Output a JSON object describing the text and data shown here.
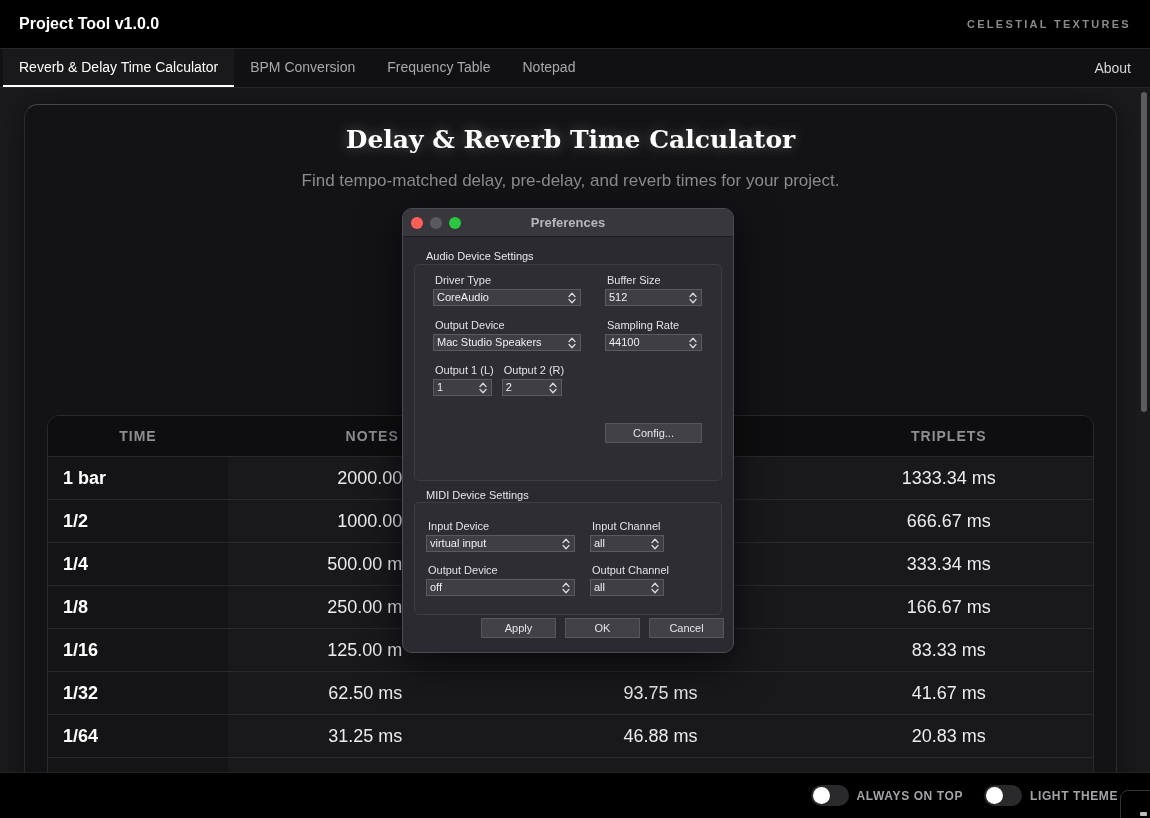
{
  "app": {
    "title": "Project Tool v1.0.0",
    "brand": "CELESTIAL TEXTURES"
  },
  "tabs": [
    {
      "label": "Reverb & Delay Time Calculator",
      "selected": true
    },
    {
      "label": "BPM Conversion",
      "selected": false
    },
    {
      "label": "Frequency Table",
      "selected": false
    },
    {
      "label": "Notepad",
      "selected": false
    }
  ],
  "about_link": "About",
  "calculator": {
    "heading": "Delay & Reverb Time Calculator",
    "subtitle": "Find tempo-matched delay, pre-delay, and reverb times for your project.",
    "table": {
      "headers": {
        "time": "TIME",
        "notes": "NOTES",
        "triplets": "TRIPLETS"
      },
      "rows": [
        {
          "time": "1 bar",
          "notes": "2000.00",
          "triplets": "1333.34 ms"
        },
        {
          "time": "1/2",
          "notes": "1000.00",
          "triplets": "666.67 ms"
        },
        {
          "time": "1/4",
          "notes": "500.00 m",
          "triplets": "333.34 ms"
        },
        {
          "time": "1/8",
          "notes": "250.00 m",
          "triplets": "166.67 ms"
        },
        {
          "time": "1/16",
          "notes": "125.00 m",
          "triplets": "83.33 ms"
        },
        {
          "time": "1/32",
          "notes": "62.50 ms",
          "column_3": "93.75 ms",
          "triplets": "41.67 ms"
        },
        {
          "time": "1/64",
          "notes": "31.25 ms",
          "column_3": "46.88 ms",
          "triplets": "20.83 ms"
        }
      ]
    }
  },
  "preferences_dialog": {
    "title": "Preferences",
    "window_buttons": [
      {
        "kind": "close",
        "disabled": false
      },
      {
        "kind": "minimize",
        "disabled": true
      },
      {
        "kind": "zoom",
        "disabled": false
      }
    ],
    "audio_settings": {
      "title": "Audio Device Settings",
      "driver_type": {
        "label": "Driver Type",
        "value": "CoreAudio"
      },
      "buffer_size": {
        "label": "Buffer Size",
        "value": "512"
      },
      "output_device": {
        "label": "Output Device",
        "value": "Mac Studio Speakers"
      },
      "sampling_rate": {
        "label": "Sampling Rate",
        "value": "44100"
      },
      "output_1": {
        "label": "Output 1 (L)",
        "value": "1"
      },
      "output_2": {
        "label": "Output 2 (R)",
        "value": "2"
      },
      "config_button": "Config..."
    },
    "midi_settings": {
      "title": "MIDI Device Settings",
      "input_device": {
        "label": "Input Device",
        "value": "virtual input"
      },
      "input_channel": {
        "label": "Input Channel",
        "value": "all"
      },
      "output_device": {
        "label": "Output Device",
        "value": "off"
      },
      "output_channel": {
        "label": "Output Channel",
        "value": "all"
      }
    },
    "buttons": [
      "Apply",
      "OK",
      "Cancel"
    ]
  },
  "footer": {
    "toggles": [
      {
        "label": "ALWAYS ON TOP",
        "on": false
      },
      {
        "label": "LIGHT THEME",
        "on": false
      }
    ]
  }
}
